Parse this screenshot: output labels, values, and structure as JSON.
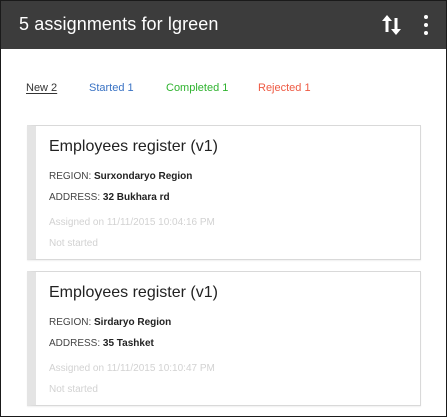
{
  "appbar": {
    "title": "5 assignments for lgreen",
    "background": "#3c3c3c",
    "icons": [
      "sync-arrows-icon",
      "more-vert-icon"
    ]
  },
  "filters": {
    "new": "New 2",
    "started": "Started 1",
    "completed": "Completed 1",
    "rejected": "Rejected 1",
    "colors": {
      "new": "#333333",
      "started": "#3a73c4",
      "completed": "#2fb32f",
      "rejected": "#ee5a43"
    }
  },
  "assignments": [
    {
      "title": "Employees register (v1)",
      "region_label": "REGION:",
      "region": "Surxondaryo Region",
      "address_label": "ADDRESS:",
      "address": "32 Bukhara rd",
      "assigned": "Assigned on 11/11/2015 10:04:16 PM",
      "status": "Not started"
    },
    {
      "title": "Employees register (v1)",
      "region_label": "REGION:",
      "region": "Sirdaryo Region",
      "address_label": "ADDRESS:",
      "address": "35 Tashket",
      "assigned": "Assigned on 11/11/2015 10:10:47 PM",
      "status": "Not started"
    }
  ]
}
